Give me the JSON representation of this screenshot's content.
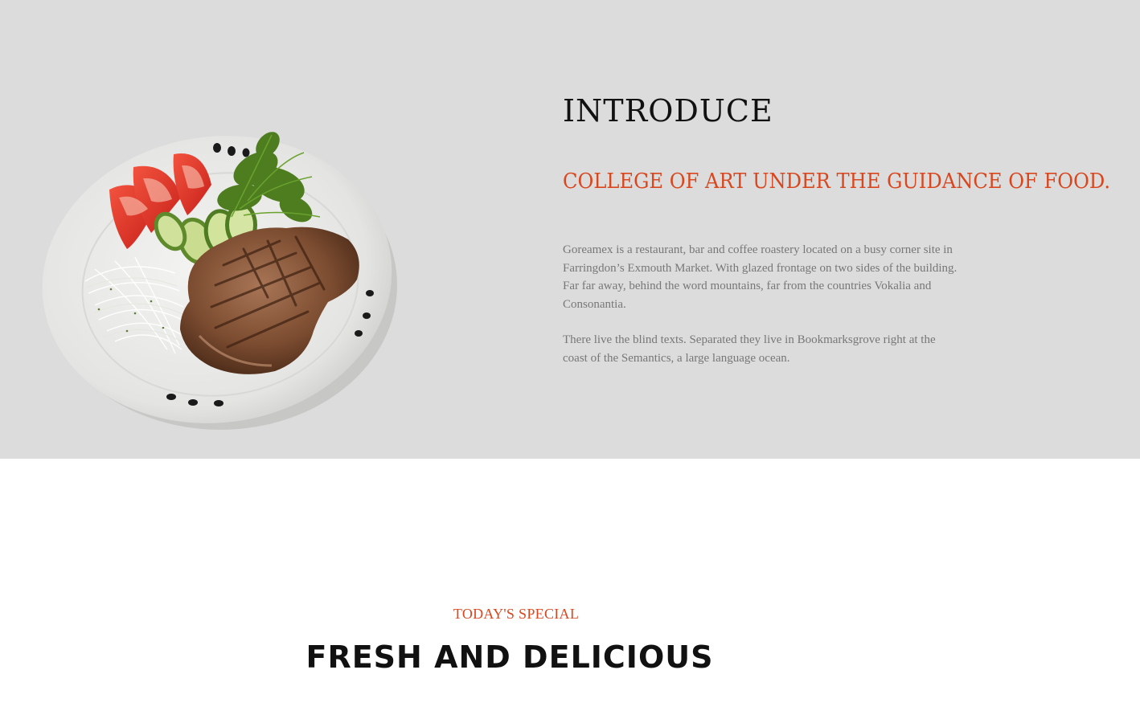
{
  "intro": {
    "title": "INTRODUCE",
    "subtitle": "COLLEGE OF ART UNDER THE GUIDANCE OF FOOD.",
    "paragraphs": [
      "Goreamex is a restaurant, bar and coffee roastery located on a busy corner site in Farringdon’s Exmouth Market. With glazed frontage on two sides of the building. Far far away, behind the word mountains, far from the countries Vokalia and Consonantia.",
      "There live the blind texts. Separated they live in Bookmarksgrove right at the coast of the Semantics, a large language ocean."
    ],
    "image_icon": "steak-plate-image"
  },
  "special": {
    "kicker": "TODAY'S SPECIAL",
    "title": "FRESH AND DELICIOUS"
  },
  "colors": {
    "accent": "#d9471f",
    "intro_background": "#dcdcdc",
    "heading": "#111111",
    "body_text": "#777777",
    "nav_indicator": "#2a5db0"
  }
}
